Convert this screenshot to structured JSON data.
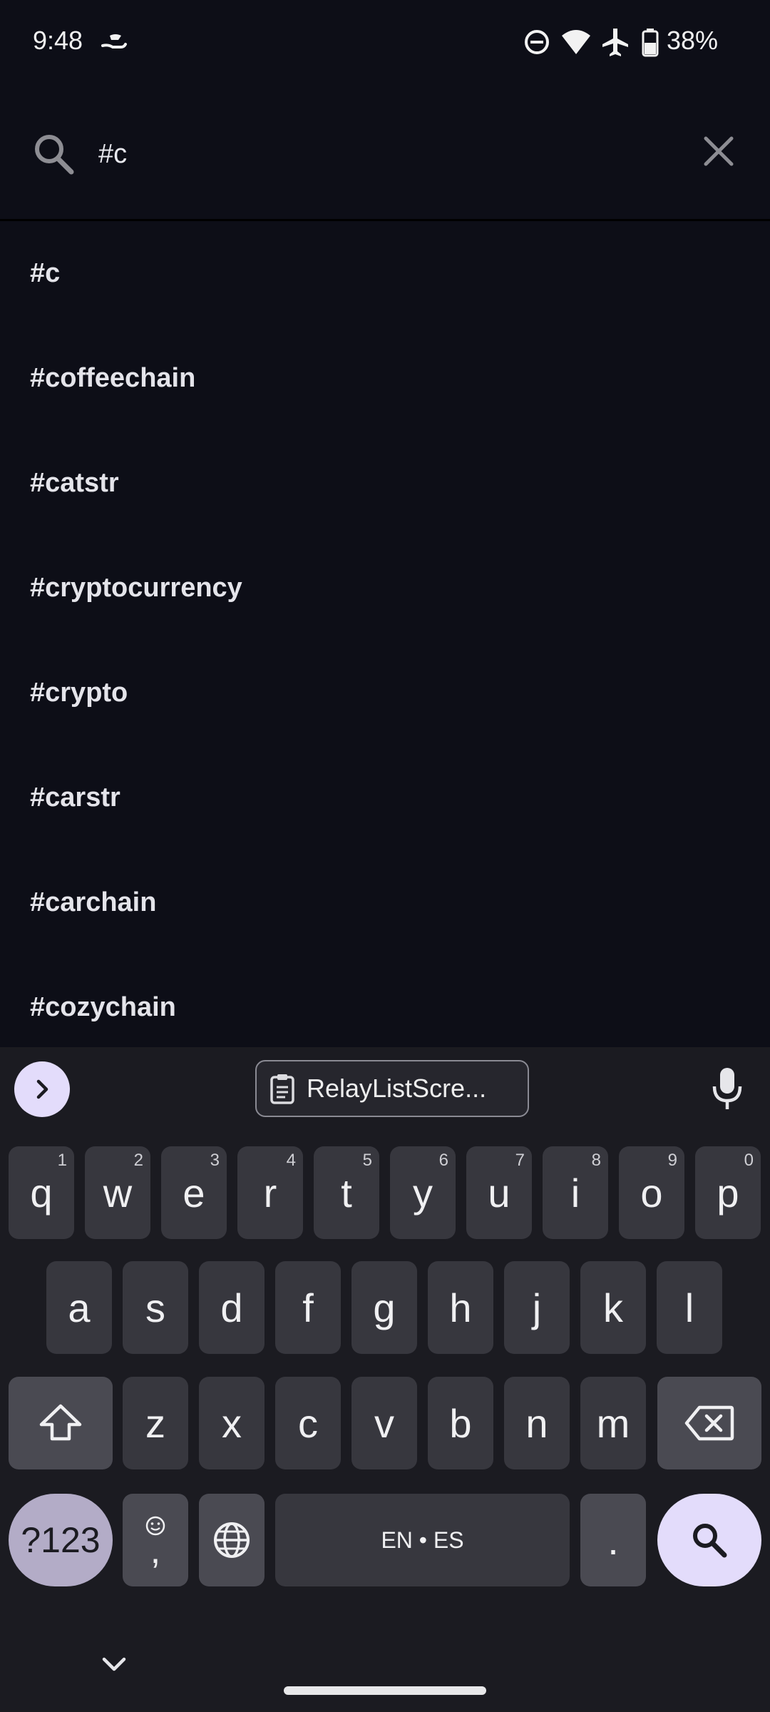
{
  "status_bar": {
    "time": "9:48",
    "battery": "38%"
  },
  "search": {
    "query": "#c",
    "icon": "search-icon",
    "clear_icon": "close-icon"
  },
  "suggestions": [
    "#c",
    "#coffeechain",
    "#catstr",
    "#cryptocurrency",
    "#crypto",
    "#carstr",
    "#carchain",
    "#cozychain"
  ],
  "keyboard": {
    "clipboard_chip": "RelayListScre...",
    "row1": [
      {
        "key": "q",
        "hint": "1"
      },
      {
        "key": "w",
        "hint": "2"
      },
      {
        "key": "e",
        "hint": "3"
      },
      {
        "key": "r",
        "hint": "4"
      },
      {
        "key": "t",
        "hint": "5"
      },
      {
        "key": "y",
        "hint": "6"
      },
      {
        "key": "u",
        "hint": "7"
      },
      {
        "key": "i",
        "hint": "8"
      },
      {
        "key": "o",
        "hint": "9"
      },
      {
        "key": "p",
        "hint": "0"
      }
    ],
    "row2": [
      "a",
      "s",
      "d",
      "f",
      "g",
      "h",
      "j",
      "k",
      "l"
    ],
    "row3": [
      "z",
      "x",
      "c",
      "v",
      "b",
      "n",
      "m"
    ],
    "symbols_label": "?123",
    "comma_label": ",",
    "space_label": "EN • ES",
    "period_label": ".",
    "accent_color": "#e3dcfb"
  }
}
